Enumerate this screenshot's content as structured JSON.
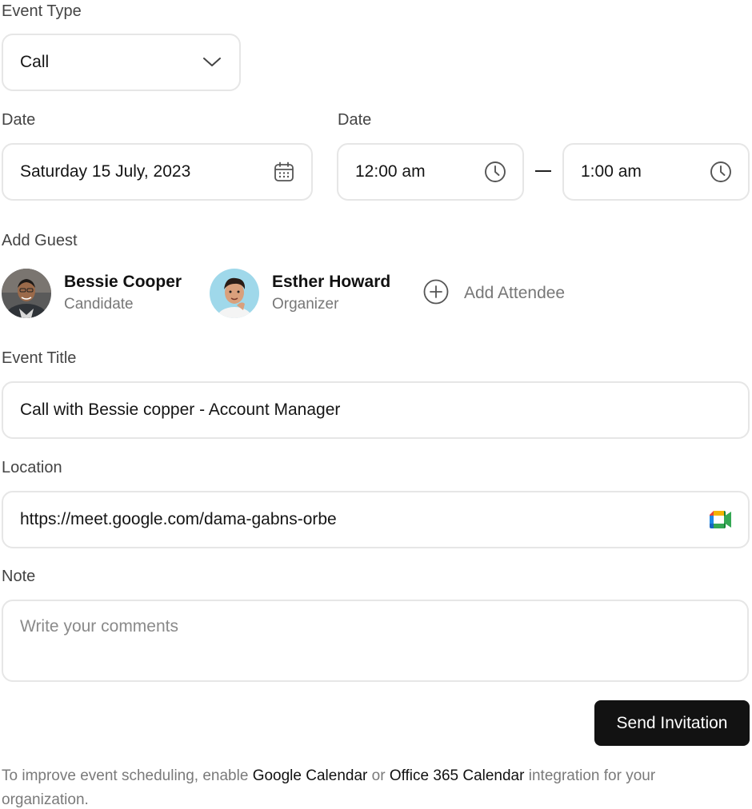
{
  "event_type": {
    "label": "Event Type",
    "value": "Call",
    "icon": "chevron-down-icon"
  },
  "date": {
    "label": "Date",
    "value": "Saturday 15 July, 2023",
    "icon": "calendar-icon"
  },
  "time": {
    "label": "Date",
    "start": "12:00 am",
    "end": "1:00 am",
    "icon": "clock-icon"
  },
  "guests": {
    "label": "Add Guest",
    "items": [
      {
        "name": "Bessie Cooper",
        "role": "Candidate"
      },
      {
        "name": "Esther Howard",
        "role": "Organizer"
      }
    ],
    "add_label": "Add Attendee",
    "add_icon": "plus-circle-icon"
  },
  "event_title": {
    "label": "Event Title",
    "value": "Call with Bessie copper - Account Manager"
  },
  "location": {
    "label": "Location",
    "value": "https://meet.google.com/dama-gabns-orbe",
    "icon": "google-meet-icon"
  },
  "note": {
    "label": "Note",
    "placeholder": "Write your comments"
  },
  "send_button": "Send Invitation",
  "footer": {
    "text_before": "To improve event scheduling, enable ",
    "link1": "Google Calendar",
    "text_mid": " or ",
    "link2": "Office 365 Calendar",
    "text_after": " integration for your organization."
  },
  "colors": {
    "button_bg": "#121212",
    "border": "#e6e6e6",
    "muted_text": "#777777"
  }
}
